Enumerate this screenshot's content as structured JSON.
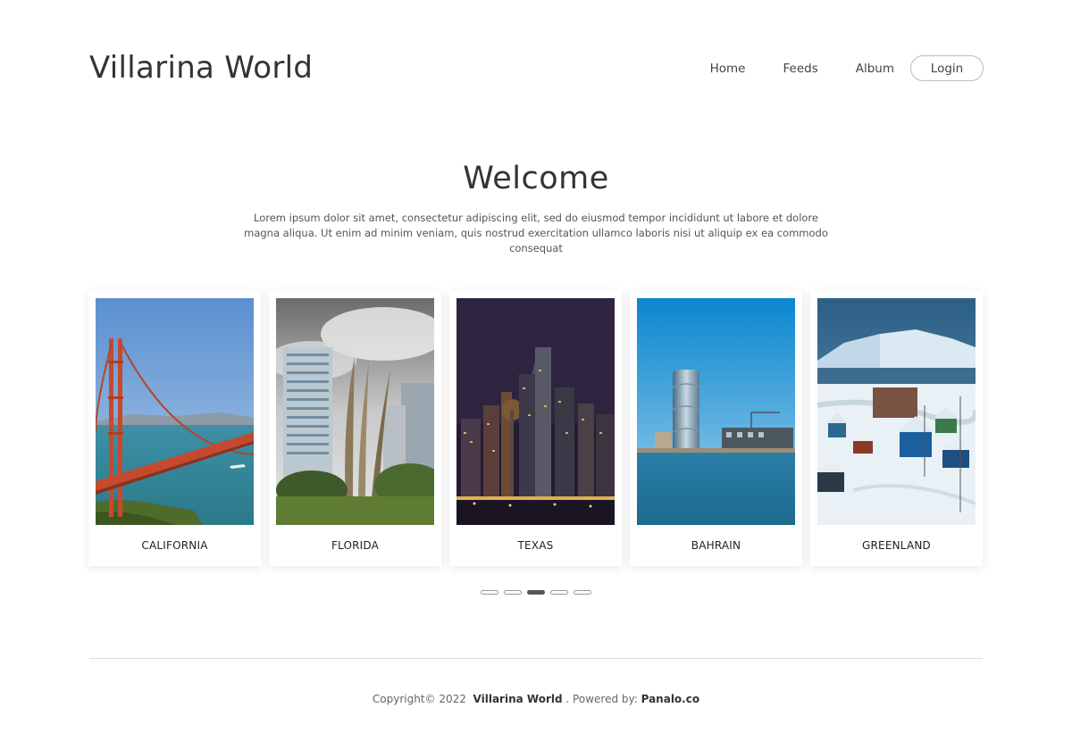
{
  "header": {
    "brand": "Villarina World",
    "nav": {
      "home": "Home",
      "feeds": "Feeds",
      "album": "Album",
      "login": "Login"
    }
  },
  "hero": {
    "title": "Welcome",
    "text": "Lorem ipsum dolor sit amet, consectetur adipiscing elit, sed do eiusmod tempor incididunt ut labore et dolore magna aliqua. Ut enim ad minim veniam, quis nostrud exercitation ullamco laboris nisi ut aliquip ex ea commodo consequat"
  },
  "carousel": {
    "cards": [
      {
        "label": "CALIFORNIA"
      },
      {
        "label": "FLORIDA"
      },
      {
        "label": "TEXAS"
      },
      {
        "label": "BAHRAIN"
      },
      {
        "label": "GREENLAND"
      }
    ],
    "slide_count": 5,
    "active_slide": 3
  },
  "footer": {
    "copyright": "Copyright© 2022",
    "site_name": "Villarina World",
    "powered_prefix": ". Powered by:",
    "powered_by": "Panalo.co"
  }
}
